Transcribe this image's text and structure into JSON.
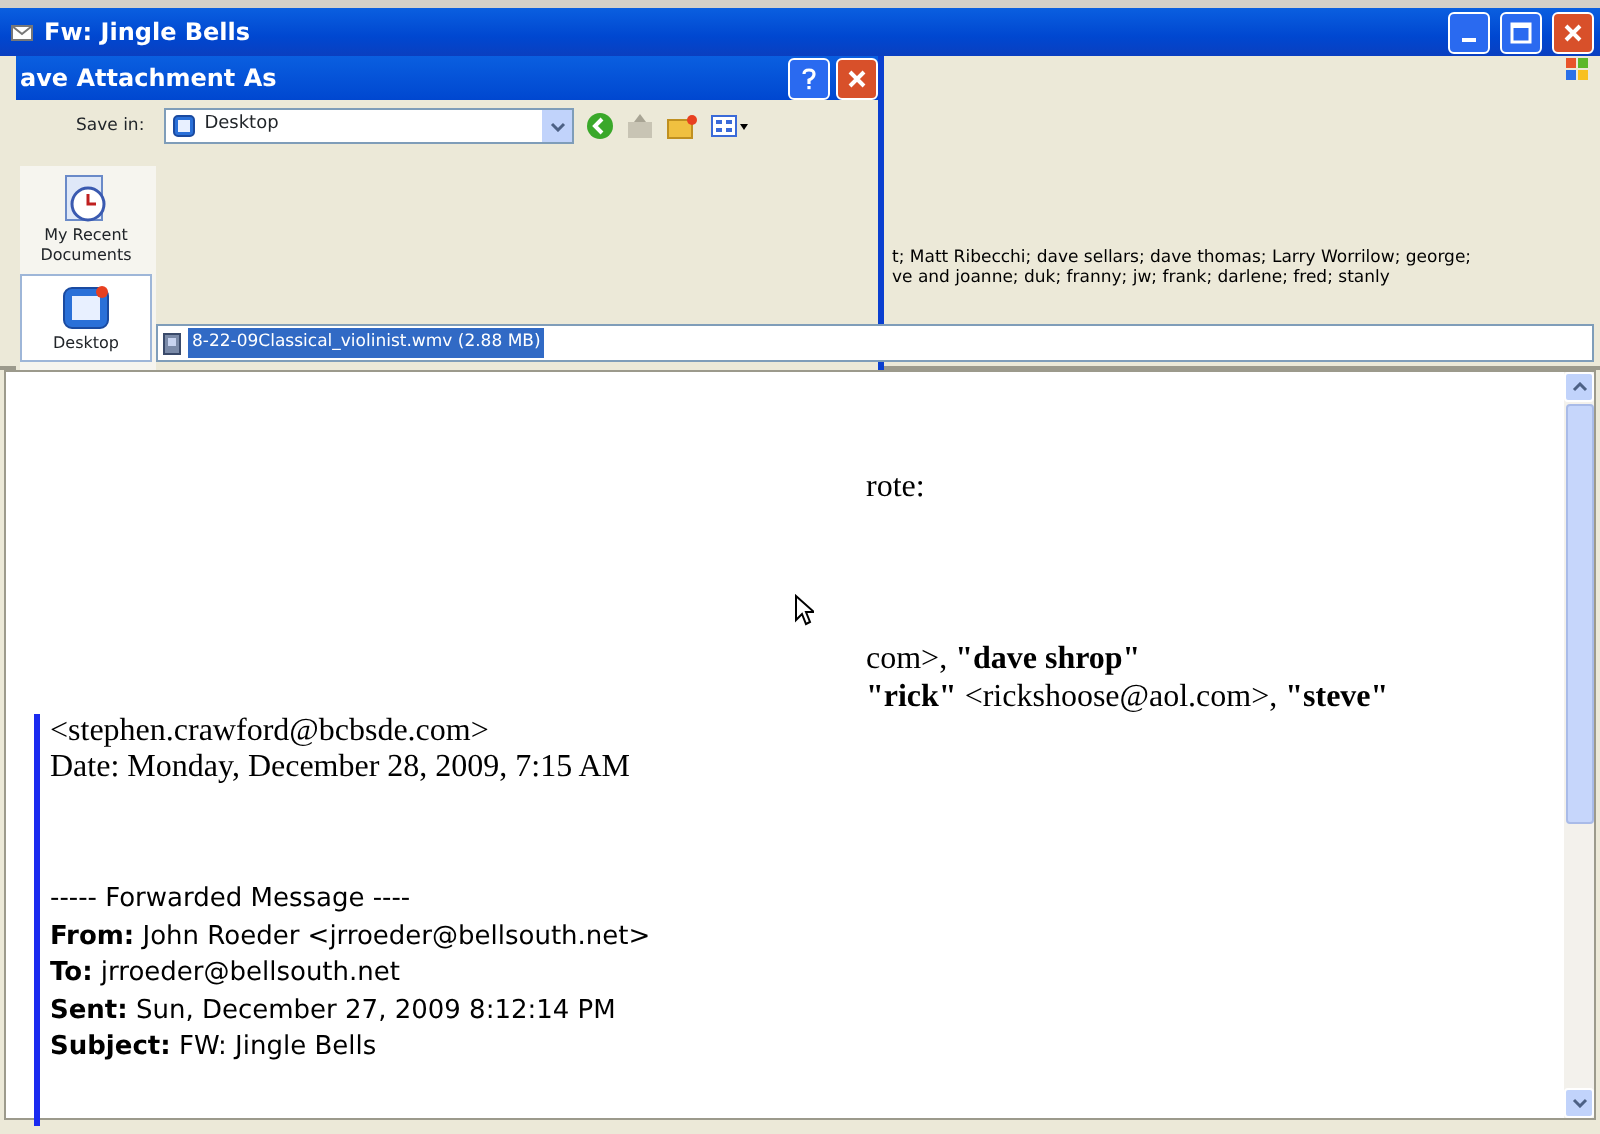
{
  "window": {
    "title": "Fw: Jingle Bells"
  },
  "header": {
    "recipient_lines": [
      "t; Matt Ribecchi; dave sellars; dave thomas; Larry Worrilow; george;",
      "ve and joanne; duk; franny; jw; frank; darlene; fred; stanly"
    ],
    "attachment": {
      "label": "8-22-09Classical_violinist.wmv (2.88 MB)",
      "selected": true
    }
  },
  "dialog": {
    "title": "ave Attachment As",
    "save_in_label": "Save in:",
    "save_in_value": "Desktop",
    "places": [
      {
        "label": "My Recent Documents",
        "selected": false
      },
      {
        "label": "Desktop",
        "selected": true
      }
    ]
  },
  "body": {
    "fragments": [
      "rote:",
      "com>, **\"dave shrop\"**",
      "**\"rick\"** <rickshoose@aol.com>, **\"steve\"**"
    ],
    "quote_lines": [
      "<stephen.crawford@bcbsde.com>",
      "Date: Monday, December 28, 2009, 7:15 AM"
    ],
    "forwarded": {
      "heading": "----- Forwarded Message ----",
      "fields": [
        {
          "label": "From:",
          "value": "John Roeder <jrroeder@bellsouth.net>"
        },
        {
          "label": "To:",
          "value": "jrroeder@bellsouth.net"
        },
        {
          "label": "Sent:",
          "value": "Sun, December 27, 2009 8:12:14 PM"
        },
        {
          "label": "Subject:",
          "value": "FW: Jingle Bells"
        }
      ]
    }
  }
}
